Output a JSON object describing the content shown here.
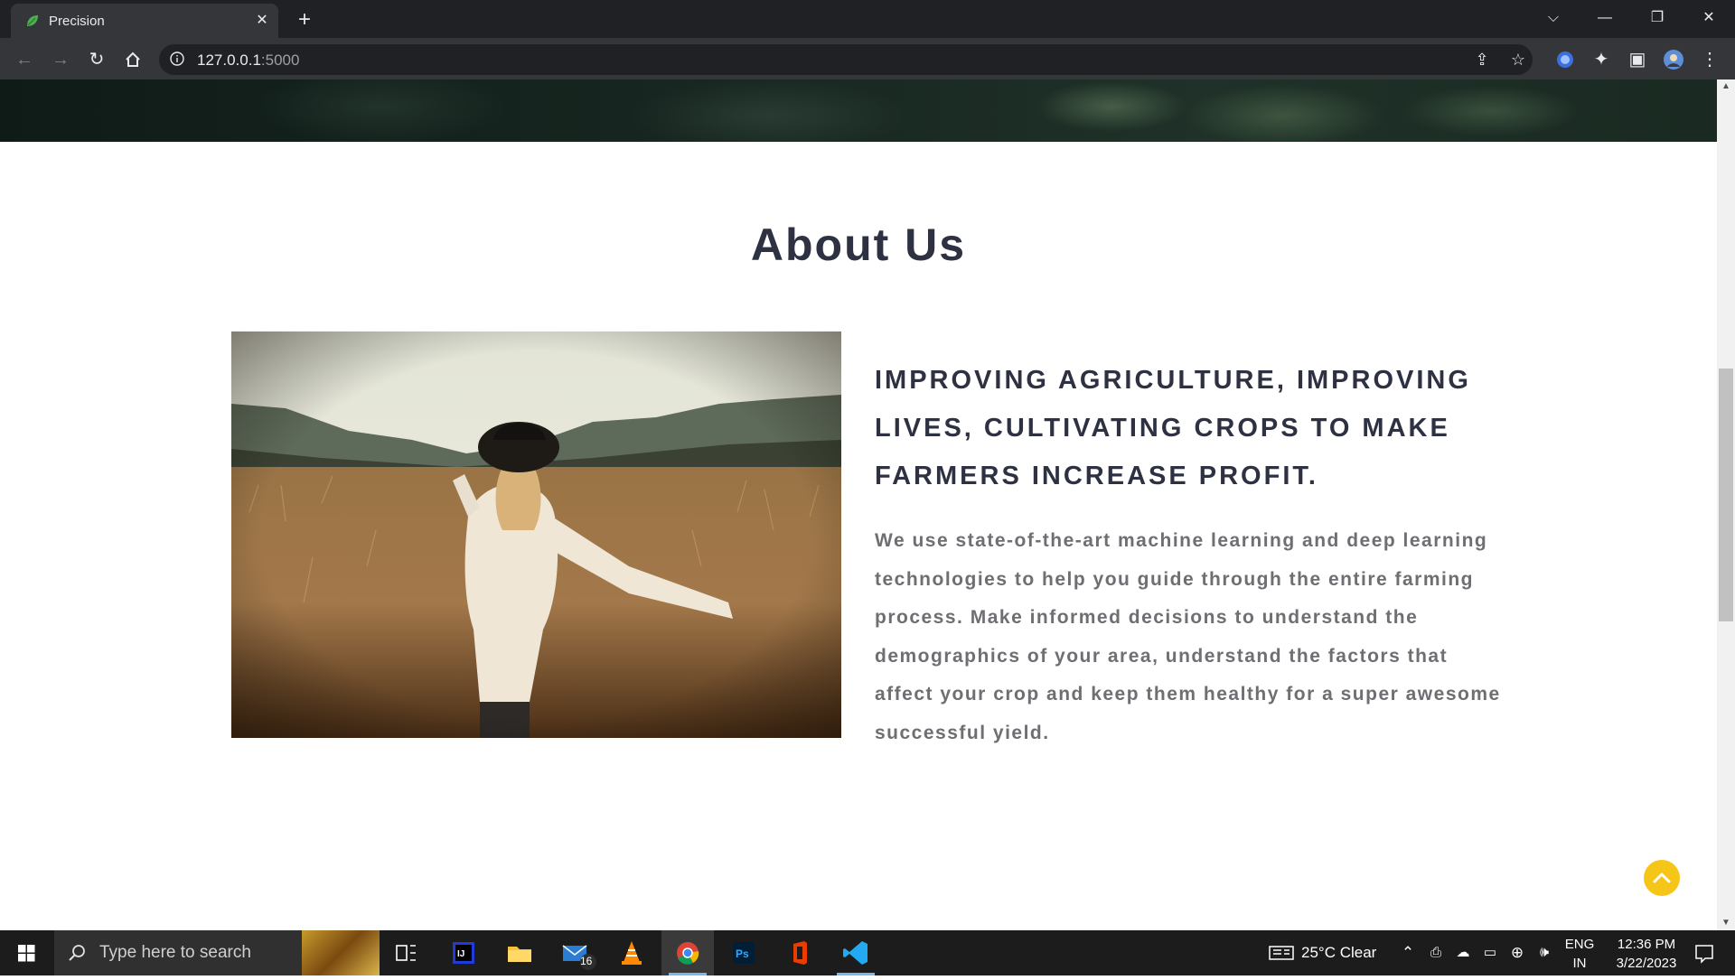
{
  "browser": {
    "tab_title": "Precision",
    "url_host": "127.0.0.1",
    "url_port": ":5000"
  },
  "page": {
    "section_title": "About Us",
    "heading": "IMPROVING AGRICULTURE, IMPROVING LIVES, CULTIVATING CROPS TO MAKE FARMERS INCREASE PROFIT.",
    "body_text": "We use state-of-the-art machine learning and deep learning technologies to help you guide through the entire farming process. Make informed decisions to understand the demographics of your area, understand the factors that affect your crop and keep them healthy for a super awesome successful yield.",
    "accent_color": "#f5c518"
  },
  "taskbar": {
    "search_placeholder": "Type here to search",
    "mail_badge": "16",
    "weather": "25°C  Clear",
    "language_top": "ENG",
    "language_bottom": "IN",
    "time": "12:36 PM",
    "date": "3/22/2023"
  }
}
